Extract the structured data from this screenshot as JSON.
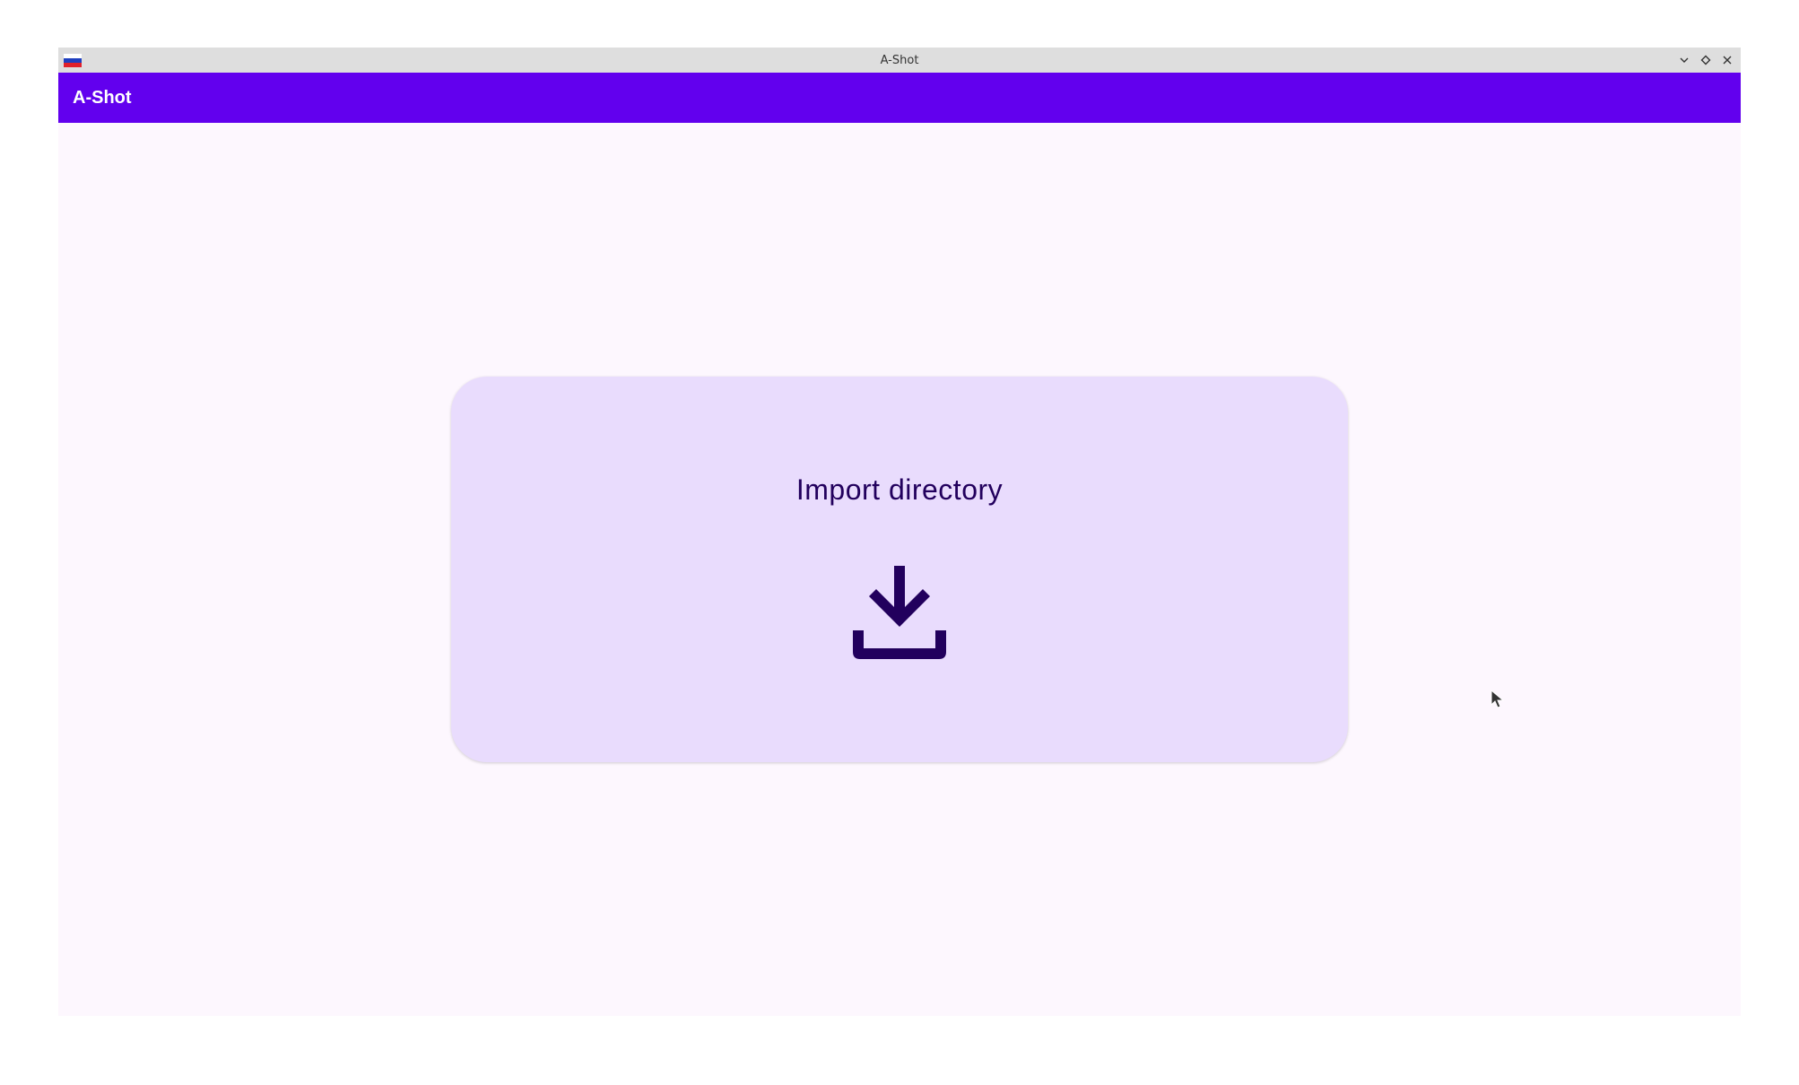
{
  "window": {
    "title": "A-Shot",
    "controls": [
      "minimize-icon",
      "maximize-icon",
      "close-icon"
    ],
    "flag_icon": "russia-flag-icon"
  },
  "appbar": {
    "title": "A-Shot",
    "color": "#6200ee"
  },
  "main": {
    "import_card": {
      "label": "Import directory",
      "icon": "download-icon",
      "background": "#e9dcfd",
      "foreground": "#22005d"
    }
  },
  "colors": {
    "page_background": "#fdf7fe",
    "titlebar_background": "#dedede"
  }
}
